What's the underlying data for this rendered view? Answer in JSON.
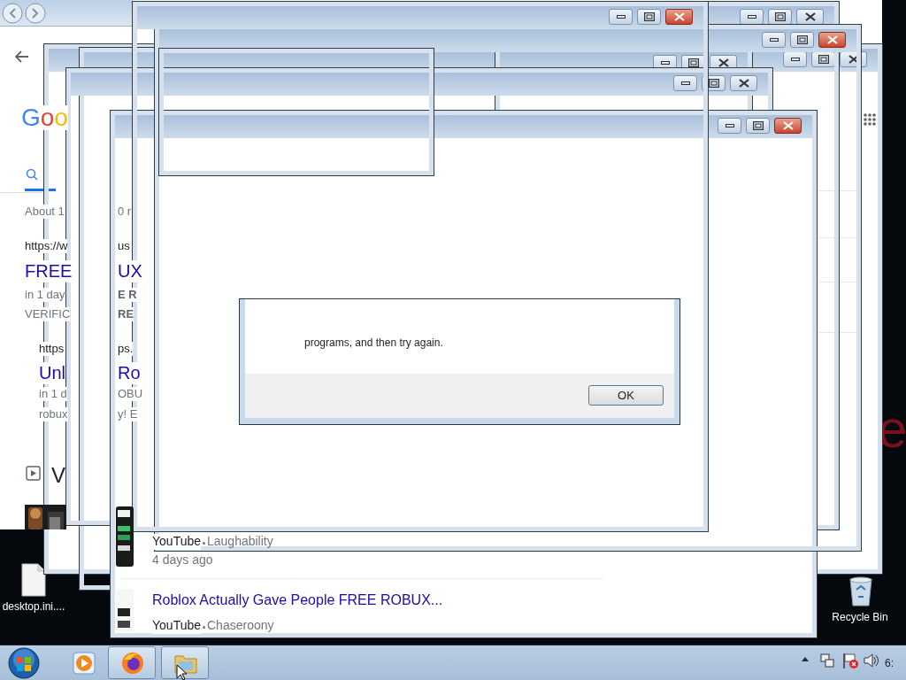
{
  "desktop": {
    "wallpaper_text": "e",
    "icons": [
      {
        "kind": "file",
        "label": "desktop.ini...."
      },
      {
        "kind": "recycle-bin",
        "label": "Recycle Bin"
      }
    ]
  },
  "windows": [
    {
      "close_highlighted": false
    },
    {
      "close_highlighted": false
    },
    {
      "close_highlighted": false
    },
    {
      "close_highlighted": false
    },
    {
      "close_highlighted": true
    },
    {
      "close_highlighted": true
    },
    {
      "close_highlighted": true
    }
  ],
  "browser_page": {
    "logo": "Goo",
    "fragments": [
      {
        "kind": "meta",
        "text": "About 1"
      },
      {
        "kind": "meta",
        "text": "0 r"
      },
      {
        "kind": "url",
        "text": "https://w"
      },
      {
        "kind": "url",
        "text": "us"
      },
      {
        "kind": "link",
        "text": "FREE"
      },
      {
        "kind": "link",
        "text": "UX"
      },
      {
        "kind": "meta",
        "text": "in 1 day"
      },
      {
        "kind": "bold",
        "text": "E R"
      },
      {
        "kind": "meta",
        "text": "VERIFIC"
      },
      {
        "kind": "bold",
        "text": "RE"
      },
      {
        "kind": "url",
        "text": "https"
      },
      {
        "kind": "url",
        "text": "ps."
      },
      {
        "kind": "link",
        "text": "Unl"
      },
      {
        "kind": "link",
        "text": "Ro"
      },
      {
        "kind": "meta",
        "text": "in 1 d"
      },
      {
        "kind": "meta",
        "text": "OBU"
      },
      {
        "kind": "meta",
        "text": "robux"
      },
      {
        "kind": "meta",
        "text": "y! E"
      },
      {
        "kind": "heading",
        "text": "V"
      }
    ],
    "results": [
      {
        "source": "YouTube",
        "channel": "Laughability",
        "age": "4 days ago"
      },
      {
        "title": "Roblox Actually Gave People FREE ROBUX...",
        "source": "YouTube",
        "channel": "Chaseroony"
      }
    ]
  },
  "dialog": {
    "message": "programs, and then try again.",
    "button": "OK"
  },
  "taskbar": {
    "items": [
      {
        "kind": "media-player",
        "running": false
      },
      {
        "kind": "firefox",
        "running": true
      },
      {
        "kind": "explorer",
        "running": true
      }
    ],
    "clock": "6:"
  }
}
